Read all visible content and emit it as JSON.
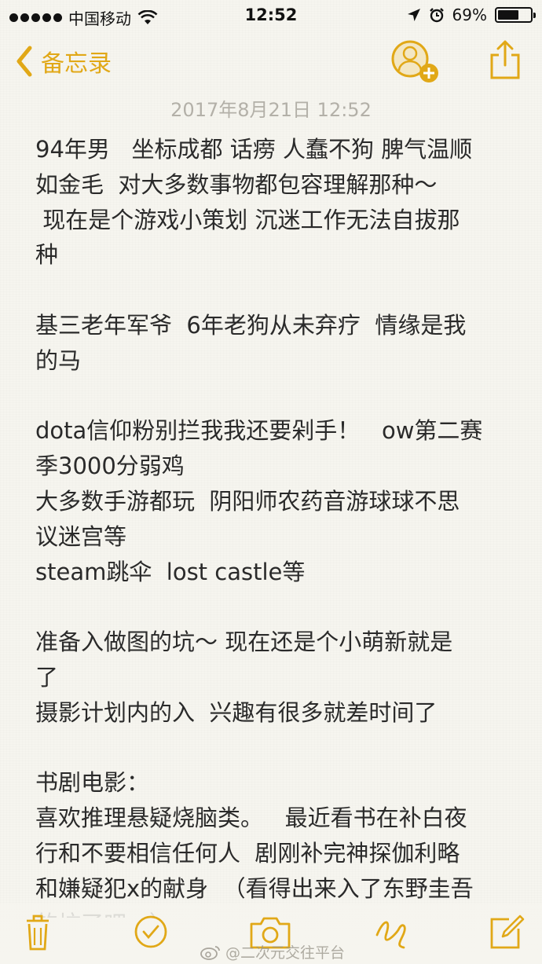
{
  "status_bar": {
    "carrier": "中国移动",
    "time": "12:52",
    "battery_percent": "69%",
    "battery_level": 0.69,
    "icons": [
      "signal-dots-icon",
      "wifi-icon",
      "location-arrow-icon",
      "alarm-clock-icon",
      "battery-icon"
    ]
  },
  "nav": {
    "back_label": "备忘录",
    "accent_color": "#e1a817",
    "icons": [
      "chevron-left-icon",
      "add-person-icon",
      "share-icon"
    ]
  },
  "note": {
    "date": "2017年8月21日 12:52",
    "lines": [
      "94年男   坐标成都 话痨 人蠢不狗 脾气温顺",
      "如金毛  对大多数事物都包容理解那种～",
      " 现在是个游戏小策划 沉迷工作无法自拔那",
      "种",
      "",
      "基三老年军爷  6年老狗从未弃疗  情缘是我",
      "的马",
      "",
      "dota信仰粉别拦我我还要剁手！   ow第二赛",
      "季3000分弱鸡",
      "大多数手游都玩  阴阳师农药音游球球不思",
      "议迷宫等",
      "steam跳伞  lost castle等",
      "",
      "准备入做图的坑～ 现在还是个小萌新就是",
      "了",
      "摄影计划内的入  兴趣有很多就差时间了",
      "",
      "书剧电影：",
      "喜欢推理悬疑烧脑类。   最近看书在补白夜",
      "行和不要相信任何人  剧刚补完神探伽利略",
      "和嫌疑犯x的献身  （看得出来入了东野圭吾",
      "的坑了吧～）"
    ]
  },
  "toolbar": {
    "icons": [
      "trash-icon",
      "checklist-icon",
      "camera-icon",
      "sketch-icon",
      "compose-icon"
    ]
  },
  "watermark": "@二次元交往平台"
}
